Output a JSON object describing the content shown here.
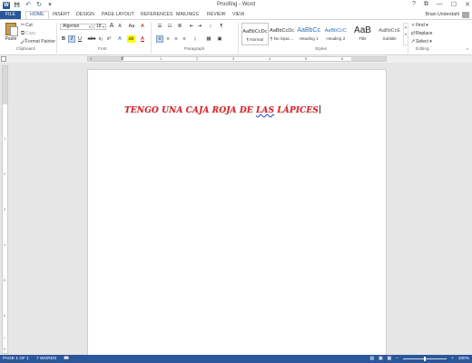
{
  "window": {
    "title": "Proofing - Word",
    "quick_access": {
      "logo": "W",
      "save": "💾",
      "undo": "↶",
      "redo": "↻",
      "customize": "▾"
    },
    "controls": {
      "help": "?",
      "ribbon_opts": "⧉",
      "minimize": "—",
      "maximize": "☐",
      "close": "✕"
    }
  },
  "tabs": [
    {
      "label": "FILE"
    },
    {
      "label": "HOME"
    },
    {
      "label": "INSERT"
    },
    {
      "label": "DESIGN"
    },
    {
      "label": "PAGE LAYOUT"
    },
    {
      "label": "REFERENCES"
    },
    {
      "label": "MAILINGS"
    },
    {
      "label": "REVIEW"
    },
    {
      "label": "VIEW"
    }
  ],
  "user": {
    "name": "Brian Underdahl"
  },
  "clipboard": {
    "paste": "Paste",
    "cut": "Cut",
    "copy": "Copy",
    "format_painter": "Format Painter",
    "group": "Clipboard"
  },
  "font": {
    "name": "Algerian",
    "size": "18",
    "group": "Font",
    "buttons": {
      "grow": "A",
      "shrink": "A",
      "case": "Aa",
      "clear": "A",
      "bold": "B",
      "italic": "I",
      "underline": "U",
      "strike": "abc",
      "sub": "x₂",
      "sup": "x²",
      "effects": "A",
      "highlight": "ab",
      "color": "A"
    }
  },
  "paragraph": {
    "group": "Paragraph",
    "buttons": [
      "☰",
      "☷",
      "≣",
      "⇤",
      "⇥",
      "↕",
      "¶",
      "≡",
      "≡",
      "≡",
      "≡",
      "↨",
      "▦",
      "▣"
    ]
  },
  "styles": {
    "group": "Styles",
    "items": [
      {
        "preview": "AaBbCcDc",
        "name": "¶ Normal"
      },
      {
        "preview": "AaBbCcDc",
        "name": "¶ No Spac..."
      },
      {
        "preview": "AaBbCc",
        "name": "Heading 1"
      },
      {
        "preview": "AaBbCcC",
        "name": "Heading 2"
      },
      {
        "preview": "AaB",
        "name": "Title"
      },
      {
        "preview": "AaBbCcE",
        "name": "Subtitle"
      }
    ]
  },
  "editing": {
    "group": "Editing",
    "find": "Find",
    "replace": "Replace",
    "select": "Select"
  },
  "ruler": {
    "numbers": [
      "1",
      "1",
      "2",
      "3",
      "4",
      "5",
      "6"
    ]
  },
  "vruler": {
    "numbers": [
      "1",
      "2",
      "3",
      "4",
      "5",
      "6",
      "7",
      "8"
    ]
  },
  "document": {
    "text_before": "TENGO UNA CAJA ROJA DE ",
    "text_error": "LAS",
    "text_after": " LÁPICES"
  },
  "status": {
    "page": "PAGE 1 OF 1",
    "words": "7 WORDS",
    "zoom": "100%"
  }
}
